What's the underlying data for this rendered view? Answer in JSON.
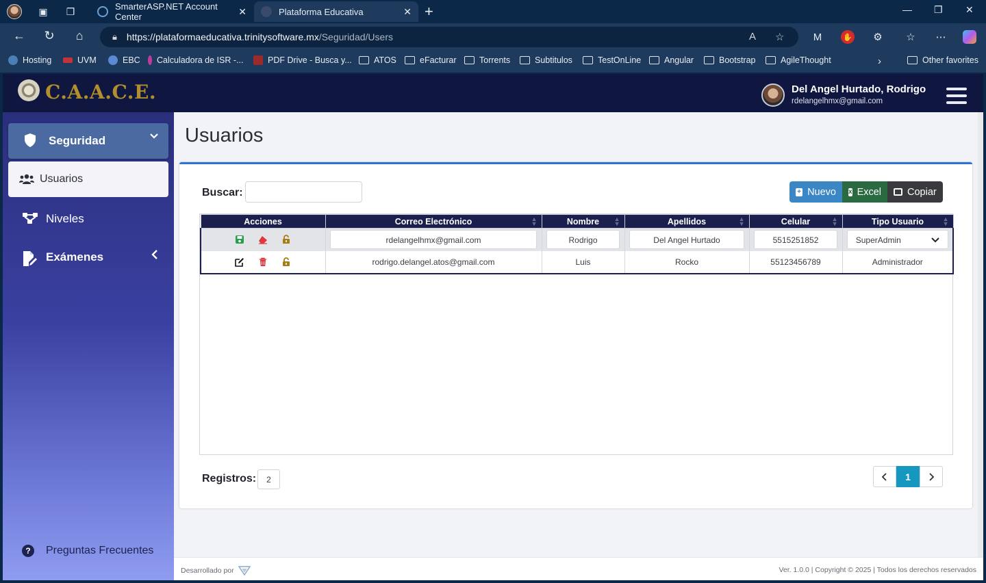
{
  "browser": {
    "tabs": [
      {
        "title": "SmarterASP.NET Account Center"
      },
      {
        "title": "Plataforma Educativa"
      }
    ],
    "url_host": "https://plataformaeducativa.trinitysoftware.mx",
    "url_path": "/Seguridad/Users",
    "favorites": [
      "Hosting",
      "UVM",
      "EBC",
      "Calculadora de ISR -...",
      "PDF Drive - Busca y...",
      "ATOS",
      "eFacturar",
      "Torrents",
      "Subtitulos",
      "TestOnLine",
      "Angular",
      "Bootstrap",
      "AgileThought"
    ],
    "other_favorites": "Other favorites",
    "colors": {
      "chrome_dark": "#0b2848",
      "chrome_light": "#1e3b5e"
    }
  },
  "app": {
    "logo": "C.A.A.C.E.",
    "user": {
      "name": "Del Angel Hurtado, Rodrigo",
      "email": "rdelangelhmx@gmail.com"
    },
    "sidebar": {
      "group": "Seguridad",
      "items": [
        {
          "label": "Usuarios",
          "icon": "users-icon"
        },
        {
          "label": "Niveles",
          "icon": "sitemap-icon"
        },
        {
          "label": "Exámenes",
          "icon": "file-edit-icon"
        }
      ],
      "faq": "Preguntas Frecuentes"
    },
    "page_title": "Usuarios",
    "search": {
      "label": "Buscar:",
      "value": ""
    },
    "buttons": {
      "nuevo": "Nuevo",
      "excel": "Excel",
      "copiar": "Copiar"
    },
    "table": {
      "headers": [
        "Acciones",
        "Correo Electrónico",
        "Nombre",
        "Apellidos",
        "Celular",
        "Tipo Usuario"
      ],
      "rows": [
        {
          "email": "rdelangelhmx@gmail.com",
          "nombre": "Rodrigo",
          "apellidos": "Del Angel Hurtado",
          "celular": "5515251852",
          "tipo": "SuperAdmin"
        },
        {
          "email": "rodrigo.delangel.atos@gmail.com",
          "nombre": "Luis",
          "apellidos": "Rocko",
          "celular": "55123456789",
          "tipo": "Administrador"
        }
      ]
    },
    "registros": {
      "label": "Registros:",
      "count": "2"
    },
    "pager": {
      "current": "1"
    },
    "footer": {
      "left": "Desarrollado por",
      "right": "Ver. 1.0.0 | Copyright © 2025 | Todos los derechos reservados"
    },
    "colors": {
      "accent": "#2c73d2",
      "header": "#0f1640",
      "table_header": "#1a1f4e",
      "nuevo": "#3b87c6",
      "excel": "#2a6a41",
      "copiar": "#383a3e",
      "active_page": "#1597c0"
    }
  }
}
